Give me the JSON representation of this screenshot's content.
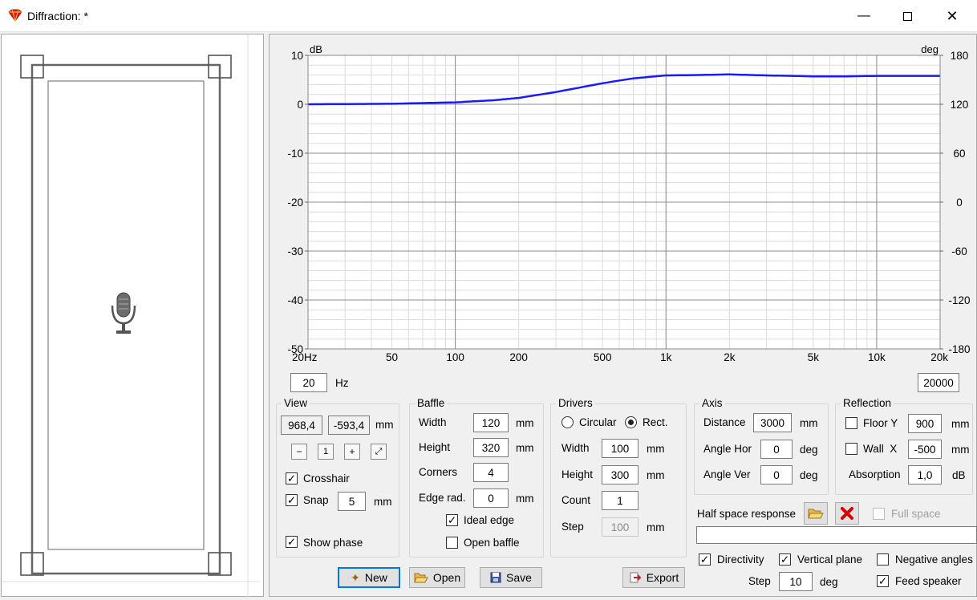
{
  "window": {
    "title": "Diffraction: *"
  },
  "chart_data": {
    "type": "line",
    "title": "",
    "ylabel": "dB",
    "y2label": "deg",
    "x_scale": "log",
    "xlim": [
      20,
      20000
    ],
    "ylim": [
      -50,
      10
    ],
    "y2lim": [
      -180,
      180
    ],
    "x_ticks": [
      {
        "v": 20,
        "t": "20Hz"
      },
      {
        "v": 50,
        "t": "50"
      },
      {
        "v": 100,
        "t": "100"
      },
      {
        "v": 200,
        "t": "200"
      },
      {
        "v": 500,
        "t": "500"
      },
      {
        "v": 1000,
        "t": "1k"
      },
      {
        "v": 2000,
        "t": "2k"
      },
      {
        "v": 5000,
        "t": "5k"
      },
      {
        "v": 10000,
        "t": "10k"
      },
      {
        "v": 20000,
        "t": "20k"
      }
    ],
    "y_ticks": [
      "10",
      "0",
      "-10",
      "-20",
      "-30",
      "-40",
      "-50"
    ],
    "y2_ticks": [
      "180",
      "120",
      "60",
      "0",
      "-60",
      "-120",
      "-180"
    ],
    "grid": true,
    "series": [
      {
        "color": "#1a1aff",
        "x": [
          20,
          50,
          100,
          150,
          200,
          300,
          500,
          700,
          1000,
          1500,
          2000,
          3000,
          4000,
          5000,
          7000,
          10000,
          15000,
          20000
        ],
        "y": [
          0,
          0.1,
          0.4,
          0.8,
          1.3,
          2.5,
          4.3,
          5.3,
          5.9,
          6.0,
          6.1,
          5.9,
          5.8,
          5.7,
          5.7,
          5.8,
          5.8,
          5.8
        ]
      }
    ]
  },
  "freq": {
    "min": "20",
    "unit": "Hz",
    "max": "20000"
  },
  "view": {
    "title": "View",
    "x": "968,4",
    "y": "-593,4",
    "unit": "mm",
    "crosshair": "Crosshair",
    "snap": "Snap",
    "snap_value": "5",
    "snap_unit": "mm",
    "show_phase": "Show phase"
  },
  "baffle": {
    "title": "Baffle",
    "width_label": "Width",
    "width": "120",
    "height_label": "Height",
    "height": "320",
    "corners_label": "Corners",
    "corners": "4",
    "edge_label": "Edge rad.",
    "edge": "0",
    "unit": "mm",
    "ideal_edge": "Ideal edge",
    "open_baffle": "Open baffle"
  },
  "drivers": {
    "title": "Drivers",
    "circular": "Circular",
    "rect": "Rect.",
    "width_label": "Width",
    "width": "100",
    "height_label": "Height",
    "height": "300",
    "count_label": "Count",
    "count": "1",
    "step_label": "Step",
    "step": "100",
    "unit": "mm"
  },
  "axis": {
    "title": "Axis",
    "distance_label": "Distance",
    "distance": "3000",
    "distance_unit": "mm",
    "hor_label": "Angle Hor",
    "hor": "0",
    "ver_label": "Angle Ver",
    "ver": "0",
    "deg": "deg"
  },
  "reflection": {
    "title": "Reflection",
    "floor_label": "Floor Y",
    "floor": "900",
    "wall_label": "Wall  X",
    "wall": "-500",
    "absorption_label": "Absorption",
    "absorption": "1,0",
    "unit": "mm",
    "db": "dB"
  },
  "half_space": {
    "label": "Half space response",
    "full_space": "Full space",
    "path": ""
  },
  "options": {
    "directivity": "Directivity",
    "vertical_plane": "Vertical plane",
    "negative_angles": "Negative angles",
    "step_label": "Step",
    "step": "10",
    "step_unit": "deg",
    "feed_speaker": "Feed speaker"
  },
  "buttons": {
    "new": "New",
    "open": "Open",
    "save": "Save",
    "export": "Export"
  }
}
